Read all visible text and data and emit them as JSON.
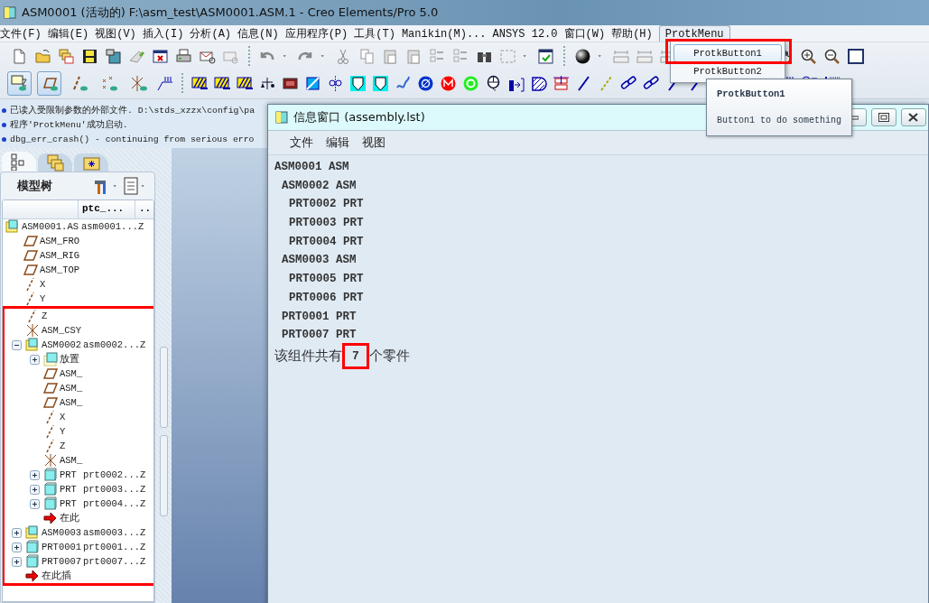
{
  "window": {
    "title": "ASM0001 (活动的) F:\\asm_test\\ASM0001.ASM.1 - Creo Elements/Pro 5.0"
  },
  "menu": [
    {
      "label": "文件(F)",
      "selected": false
    },
    {
      "label": "编辑(E)",
      "selected": false
    },
    {
      "label": "视图(V)",
      "selected": false
    },
    {
      "label": "插入(I)",
      "selected": false
    },
    {
      "label": "分析(A)",
      "selected": false
    },
    {
      "label": "信息(N)",
      "selected": false
    },
    {
      "label": "应用程序(P)",
      "selected": false
    },
    {
      "label": "工具(T)",
      "selected": false
    },
    {
      "label": "Manikin(M)...",
      "selected": false
    },
    {
      "label": "ANSYS 12.0",
      "selected": false
    },
    {
      "label": "窗口(W)",
      "selected": false
    },
    {
      "label": "帮助(H)",
      "selected": false
    },
    {
      "label": "ProtkMenu",
      "selected": true
    }
  ],
  "datum_display_toggles": [
    {
      "kind": "plane-tag",
      "on": true
    },
    {
      "kind": "plane",
      "on": true
    },
    {
      "kind": "axis",
      "on": false
    },
    {
      "kind": "point",
      "on": false
    },
    {
      "kind": "csys",
      "on": false
    }
  ],
  "messages": [
    "已读入受限制参数的外部文件. D:\\stds_xzzx\\config\\pa",
    "程序'ProtkMenu'成功启动.",
    "dbg_err_crash() - continuing from serious erro"
  ],
  "navigator_tabs": [
    {
      "kind": "tree",
      "selected": true
    },
    {
      "kind": "layers",
      "selected": false
    },
    {
      "kind": "favorites",
      "selected": false
    }
  ],
  "model_tree": {
    "title": "模型树",
    "columns": [
      "ptc_...",
      ".."
    ],
    "items": [
      {
        "name": "ASM0001.AS",
        "kind": "assembly",
        "ptc_value": "asm0001...",
        "column_3": "Z",
        "children": [
          {
            "name": "ASM_FRO",
            "kind": "plane",
            "annotated": false
          },
          {
            "name": "ASM_RIG",
            "kind": "plane",
            "annotated": false
          },
          {
            "name": "ASM_TOP",
            "kind": "plane",
            "annotated": false
          },
          {
            "name": "X",
            "kind": "axis",
            "annotated": false
          },
          {
            "name": "Y",
            "kind": "axis",
            "annotated": false
          },
          {
            "name": "Z",
            "kind": "axis",
            "annotated": true
          },
          {
            "name": "ASM_CSY",
            "kind": "csys",
            "annotated": true
          },
          {
            "name": "ASM0002",
            "kind": "assembly",
            "ptc_value": "asm0002...",
            "column_3": "Z",
            "expanded": true,
            "annotated": true,
            "children": [
              {
                "name": "放置",
                "kind": "placement",
                "expanded": false
              },
              {
                "name": "ASM_",
                "kind": "plane"
              },
              {
                "name": "ASM_",
                "kind": "plane"
              },
              {
                "name": "ASM_",
                "kind": "plane"
              },
              {
                "name": "X",
                "kind": "axis"
              },
              {
                "name": "Y",
                "kind": "axis"
              },
              {
                "name": "Z",
                "kind": "axis"
              },
              {
                "name": "ASM_",
                "kind": "csys"
              },
              {
                "name": "PRT",
                "kind": "part",
                "ptc_value": "prt0002...",
                "column_3": "Z",
                "expanded": false
              },
              {
                "name": "PRT",
                "kind": "part",
                "ptc_value": "prt0003...",
                "column_3": "Z",
                "expanded": false
              },
              {
                "name": "PRT",
                "kind": "part",
                "ptc_value": "prt0004...",
                "column_3": "Z",
                "expanded": false
              },
              {
                "name": "在此",
                "kind": "insert"
              }
            ]
          },
          {
            "name": "ASM0003",
            "kind": "assembly",
            "ptc_value": "asm0003...",
            "column_3": "Z",
            "expanded": false,
            "annotated": true
          },
          {
            "name": "PRT0001",
            "kind": "part",
            "ptc_value": "prt0001...",
            "column_3": "Z",
            "expanded": false,
            "annotated": true
          },
          {
            "name": "PRT0007",
            "kind": "part",
            "ptc_value": "prt0007...",
            "column_3": "Z",
            "expanded": false,
            "annotated": true
          },
          {
            "name": "在此插",
            "kind": "insert",
            "annotated": true
          }
        ]
      }
    ]
  },
  "info_window": {
    "title": "信息窗口 (assembly.lst)",
    "menu": [
      "文件",
      "编辑",
      "视图"
    ],
    "lines": [
      {
        "text": "ASM0001 ASM",
        "children": [
          {
            "text": "ASM0002 ASM",
            "children": [
              {
                "text": "PRT0002 PRT"
              },
              {
                "text": "PRT0003 PRT"
              },
              {
                "text": "PRT0004 PRT"
              }
            ]
          },
          {
            "text": "ASM0003 ASM",
            "children": [
              {
                "text": "PRT0005 PRT"
              },
              {
                "text": "PRT0006 PRT"
              }
            ]
          },
          {
            "text": "PRT0001 PRT"
          },
          {
            "text": "PRT0007 PRT"
          }
        ]
      }
    ],
    "summary": {
      "before": "该组件共有",
      "count": "7",
      "after": "个零件",
      "annotated": true
    }
  },
  "protk_menu": {
    "items": [
      {
        "label": "ProtkButton1",
        "selected": true,
        "annotated": true
      },
      {
        "label": "ProtkButton2",
        "selected": false,
        "annotated": false
      }
    ]
  },
  "tooltip": {
    "title": "ProtkButton1",
    "text": "Button1 to do something"
  }
}
